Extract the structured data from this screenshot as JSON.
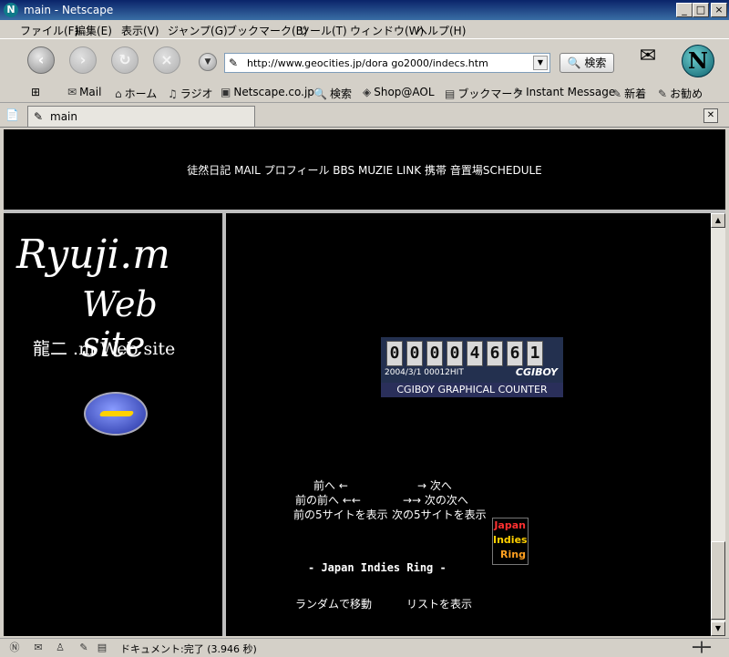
{
  "window": {
    "title": "main - Netscape",
    "app_icon": "netscape-n-icon",
    "controls": {
      "minimize": "_",
      "maximize": "□",
      "close": "×"
    }
  },
  "menu": [
    "ファイル(F)",
    "編集(E)",
    "表示(V)",
    "ジャンプ(G)",
    "ブックマーク(B)",
    "ツール(T)",
    "ウィンドウ(W)",
    "ヘルプ(H)"
  ],
  "toolbar": {
    "url": "http://www.geocities.jp/dora go2000/indecs.htm",
    "search_label": "検索",
    "buttons": [
      "back-icon",
      "forward-icon",
      "reload-icon",
      "stop-icon"
    ]
  },
  "personal_toolbar": [
    {
      "label": "Mail",
      "icon": "mail-icon"
    },
    {
      "label": "ホーム",
      "icon": "home-icon"
    },
    {
      "label": "ラジオ",
      "icon": "headphones-icon"
    },
    {
      "label": "Netscape.co.jp",
      "icon": "my-icon"
    },
    {
      "label": "検索",
      "icon": "search-icon"
    },
    {
      "label": "Shop@AOL",
      "icon": "shop-icon"
    },
    {
      "label": "ブックマーク",
      "icon": "folder-icon"
    },
    {
      "label": "Instant Message",
      "icon": "bookmark-icon"
    },
    {
      "label": "新着",
      "icon": "bookmark-icon"
    },
    {
      "label": "お勧め",
      "icon": "bookmark-icon"
    }
  ],
  "tab": {
    "label": "main"
  },
  "page": {
    "top_nav": [
      "徒然日記",
      "MAIL",
      "プロフィール",
      "BBS",
      "MUZIE",
      "LINK",
      "携帯",
      "音置場",
      "SCHEDULE"
    ],
    "logo_line1": "Ryuji.m",
    "logo_line2": "Web site",
    "site_title": "龍二 .m Web site",
    "counter": {
      "digits": [
        "0",
        "0",
        "0",
        "0",
        "4",
        "6",
        "6",
        "1"
      ],
      "info": "2004/3/1  00012HIT",
      "brand": "CGIBOY",
      "label": "CGIBOY GRAPHICAL COUNTER"
    },
    "ring": {
      "prev": "前へ ←",
      "next": "→ 次へ",
      "prev_prev": "前の前へ ←←",
      "next_next": "→→ 次の次へ",
      "prev5": "前の5サイトを表示",
      "next5": "次の5サイトを表示",
      "name": "- Japan Indies Ring -",
      "random": "ランダムで移動",
      "list": "リストを表示",
      "banner": [
        "Japan",
        "Indies",
        "Ring"
      ],
      "banner_colors": [
        "#ff3030",
        "#ffd000",
        "#ffa020"
      ]
    }
  },
  "status": {
    "text": "ドキュメント:完了 (3.946 秒)"
  }
}
